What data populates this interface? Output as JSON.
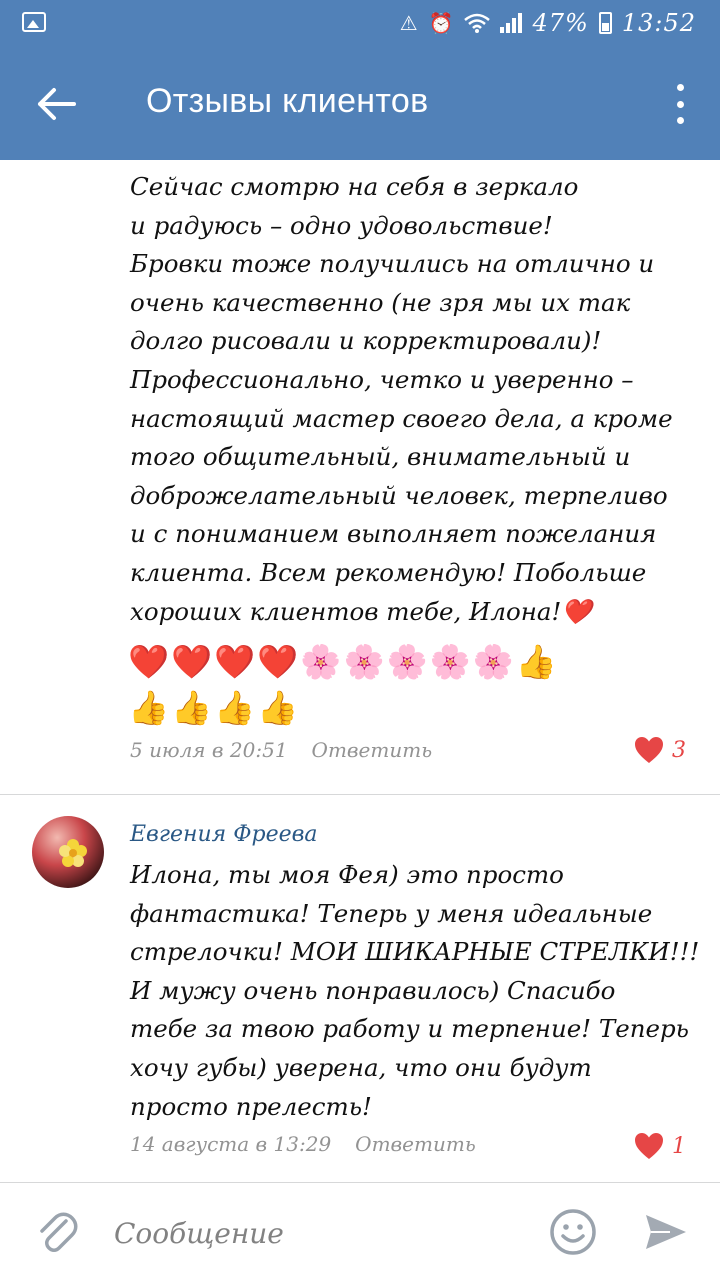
{
  "status_bar": {
    "battery": "47%",
    "time": "13:52"
  },
  "toolbar": {
    "title": "Отзывы клиентов"
  },
  "comments": [
    {
      "text": "Сейчас смотрю на себя в зеркало\nи радуюсь – одно удовольствие!\nБровки тоже получились на отлично и\nочень качественно (не зря мы их так\nдолго рисовали и корректировали)!\nПрофессионально, четко и уверенно –\nнастоящий мастер своего дела, а кроме\nтого общительный, внимательный и\nдоброжелательный человек, терпеливо\nи с пониманием выполняет пожелания\nклиента. Всем рекомендую! Побольше\nхороших клиентов тебе, Илона!❤️",
      "emoji_line_1": "❤️❤️❤️❤️🌸🌸🌸🌸🌸👍",
      "emoji_line_2": "👍👍👍👍",
      "date": "5 июля в 20:51",
      "reply_label": "Ответить",
      "likes": "3"
    },
    {
      "author": "Евгения Фреева",
      "text": "Илона, ты моя Фея) это просто\nфантастика! Теперь у меня идеальные\nстрелочки! МОИ ШИКАРНЫЕ СТРЕЛКИ!!!\nИ мужу очень понравилось) Спасибо\nтебе за твою работу и терпение! Теперь\nхочу губы) уверена, что они будут\nпросто прелесть!",
      "date": "14 августа в 13:29",
      "reply_label": "Ответить",
      "likes": "1"
    }
  ],
  "composer": {
    "placeholder": "Сообщение"
  },
  "colors": {
    "header": "#5181b8",
    "author": "#2a5885",
    "like": "#e64646",
    "meta": "#939393"
  }
}
